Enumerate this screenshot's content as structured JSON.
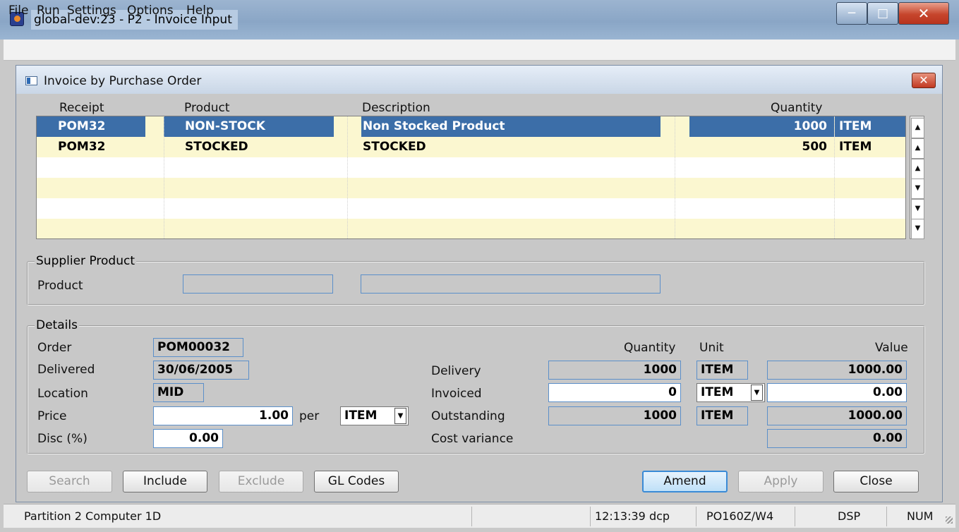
{
  "window": {
    "title": "global-dev:23 - P2 - Invoice Input"
  },
  "menu": [
    "File",
    "Run",
    "Settings",
    "Options",
    "Help"
  ],
  "dialog": {
    "title": "Invoice by Purchase Order"
  },
  "grid": {
    "headers": {
      "receipt": "Receipt",
      "product": "Product",
      "description": "Description",
      "quantity": "Quantity"
    },
    "rows": [
      {
        "receipt": "POM32",
        "product": "NON-STOCK",
        "description": "Non Stocked Product",
        "quantity": "1000",
        "unit": "ITEM",
        "selected": true
      },
      {
        "receipt": "POM32",
        "product": "STOCKED",
        "description": "STOCKED",
        "quantity": "500",
        "unit": "ITEM",
        "selected": false
      }
    ]
  },
  "supplier_product": {
    "group_title": "Supplier Product",
    "product_label": "Product",
    "product_code": "",
    "product_description": ""
  },
  "details": {
    "group_title": "Details",
    "order_label": "Order",
    "order": "POM00032",
    "delivered_label": "Delivered",
    "delivered": "30/06/2005",
    "location_label": "Location",
    "location": "MID",
    "price_label": "Price",
    "price": "1.00",
    "per_label": "per",
    "price_unit": "ITEM",
    "disc_label": "Disc (%)",
    "disc": "0.00",
    "quantity_header": "Quantity",
    "unit_header": "Unit",
    "value_header": "Value",
    "delivery_label": "Delivery",
    "delivery_qty": "1000",
    "delivery_unit": "ITEM",
    "delivery_value": "1000.00",
    "invoiced_label": "Invoiced",
    "invoiced_qty": "0",
    "invoiced_unit": "ITEM",
    "invoiced_value": "0.00",
    "outstanding_label": "Outstanding",
    "outstanding_qty": "1000",
    "outstanding_unit": "ITEM",
    "outstanding_value": "1000.00",
    "cost_variance_label": "Cost variance",
    "cost_variance_value": "0.00"
  },
  "buttons": {
    "search": "Search",
    "include": "Include",
    "exclude": "Exclude",
    "gl_codes": "GL Codes",
    "amend": "Amend",
    "apply": "Apply",
    "close": "Close"
  },
  "status": {
    "partition": "Partition 2 Computer 1D",
    "time_user": "12:13:39  dcp",
    "program": "PO160Z/W4",
    "mode": "DSP",
    "num": "NUM"
  },
  "colors": {
    "selection": "#3c6ea8",
    "stripe": "#fbf7d0",
    "field_border": "#5b8fc9"
  }
}
